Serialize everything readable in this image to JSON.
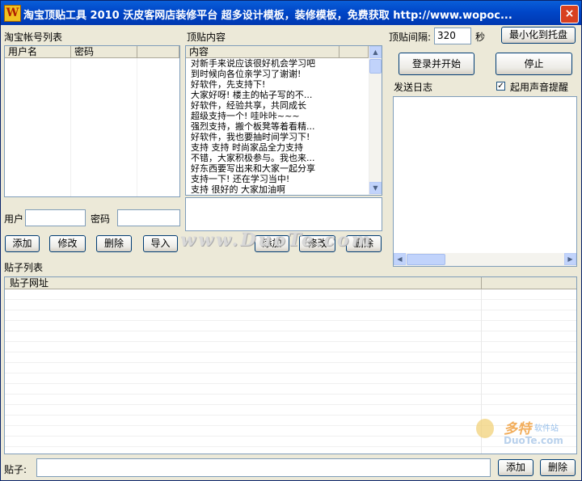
{
  "window": {
    "title": "淘宝顶贴工具 2010  沃皮客网店装修平台  超多设计模板，装修模板，免费获取 http://www.wopoc...",
    "close_symbol": "×"
  },
  "accounts": {
    "label": "淘宝帐号列表",
    "columns": [
      "用户名",
      "密码"
    ],
    "user_label": "用户",
    "user_value": "",
    "password_label": "密码",
    "password_value": "",
    "buttons": [
      "添加",
      "修改",
      "删除",
      "导入"
    ]
  },
  "content": {
    "label": "顶贴内容",
    "column": "内容",
    "items": [
      "对新手来说应该很好机会学习吧",
      "到时候向各位亲学习了谢谢!",
      "好软件，先支持下!",
      "大家好呀! 楼主的帖子写的不...",
      "好软件，经验共享，共同成长",
      "超级支持一个! 哇咔咔~~~",
      "强烈支持，搬个板凳等着看精...",
      "好软件，我也要抽时间学习下!",
      "支持 支持 时尚家品全力支持",
      "不错，大家积极参与。我也来...",
      "好东西要写出来和大家一起分享",
      "支持一下! 还在学习当中!",
      "支持 很好的 大家加油啊"
    ],
    "edit_value": "",
    "buttons": [
      "添加",
      "修改",
      "删除"
    ]
  },
  "settings": {
    "interval_label": "顶贴间隔:",
    "interval_value": "320",
    "interval_unit": "秒",
    "minimize_button": "最小化到托盘",
    "login_button": "登录并开始",
    "stop_button": "停止",
    "log_label": "发送日志",
    "sound_label": "起用声音提醒",
    "sound_checked": true
  },
  "posts": {
    "label": "贴子列表",
    "column": "贴子网址",
    "input_label": "贴子:",
    "input_value": "",
    "buttons": [
      "添加",
      "删除"
    ]
  },
  "watermarks": {
    "center": "www.DuoTe.com",
    "logo_main": "多特",
    "logo_sub": "软件站",
    "logo_url": "DuoTe.com"
  }
}
